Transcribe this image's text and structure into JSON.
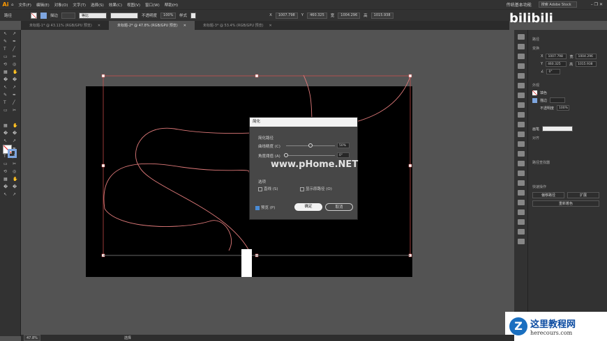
{
  "app": {
    "logo": "Ai"
  },
  "menu": [
    "文件(F)",
    "编辑(E)",
    "对象(O)",
    "文字(T)",
    "选择(S)",
    "效果(C)",
    "视图(V)",
    "窗口(W)",
    "帮助(H)"
  ],
  "workspace": "传统基本功能",
  "search_placeholder": "搜索 Adobe Stock",
  "control": {
    "type": "路径",
    "stroke_label": "描边",
    "brush": "等比",
    "opacity_label": "不透明度",
    "opacity": "100%",
    "style_label": "样式",
    "x_label": "X",
    "x": "1007.798",
    "y_label": "Y",
    "y": "460.325",
    "w_label": "宽",
    "w": "1004.296",
    "h_label": "高",
    "h": "1015.938"
  },
  "tabs": [
    "未标题-1* @ 43.11% (RGB/GPU 预览)",
    "未标题-2* @ 47.8% (RGB/GPU 预览)",
    "未标题-3* @ 53.4% (RGB/GPU 预览)"
  ],
  "dialog": {
    "title": "简化",
    "section": "简化路径",
    "curve_label": "曲线精度 (C)",
    "curve_value": "50%",
    "curve_pct": 50,
    "angle_label": "角度阈值 (A)",
    "angle_value": "0°",
    "angle_pct": 0,
    "options_label": "选项",
    "straight": "直线 (S)",
    "show_original": "显示原路径 (O)",
    "preview": "预览 (P)",
    "preview_checked": true,
    "ok": "确定",
    "cancel": "取消"
  },
  "panel": {
    "path": "路径",
    "transform": "变换",
    "x": "1007.798",
    "y": "460.325",
    "w": "1004.296",
    "h": "1015.938",
    "angle": "0°",
    "appearance": "外观",
    "stroke": "描边",
    "fill": "填色",
    "opacity_label": "不透明度",
    "opacity": "100%",
    "brush": "画笔",
    "align": "对齐",
    "pathfinder": "路径查找器",
    "quick": "快速操作",
    "offset": "偏移路径",
    "expand": "扩展",
    "recolor": "重新着色"
  },
  "status": {
    "zoom": "47.8%",
    "tool": "选择"
  },
  "watermarks": {
    "bili": "bilibili",
    "phome": "www.pHome.NET",
    "site": "这里教程网",
    "site_url": "herecours.com"
  },
  "colors": {
    "accent": "#ff9a00",
    "path": "#e07a7a",
    "selection": "#d9534f"
  }
}
